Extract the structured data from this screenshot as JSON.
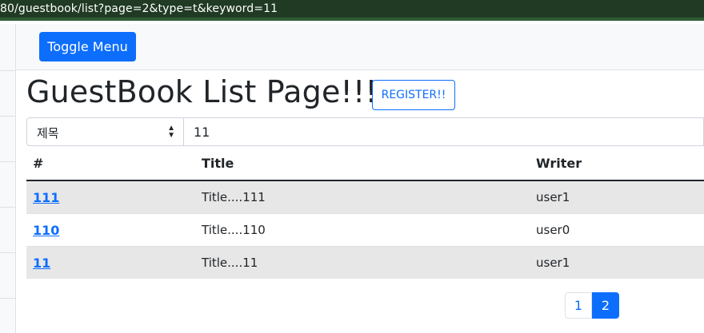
{
  "browser": {
    "url_text": "80/guestbook/list?page=2&type=t&keyword=11"
  },
  "navbar": {
    "toggle_label": "Toggle Menu"
  },
  "page": {
    "title": "GuestBook List Page!!!!",
    "register_label": "REGISTER!!"
  },
  "search": {
    "type_selected": "제목",
    "keyword_value": "11"
  },
  "table": {
    "headers": [
      "#",
      "Title",
      "Writer"
    ],
    "rows": [
      {
        "num": "111",
        "title": "Title....111",
        "writer": "user1"
      },
      {
        "num": "110",
        "title": "Title....110",
        "writer": "user0"
      },
      {
        "num": "11",
        "title": "Title....11",
        "writer": "user1"
      }
    ]
  },
  "pagination": {
    "pages": [
      "1",
      "2"
    ],
    "active": "2"
  },
  "colors": {
    "primary": "#0d6efd",
    "url_bar_bg": "#203a24",
    "striped_row": "#e7e7e7"
  }
}
